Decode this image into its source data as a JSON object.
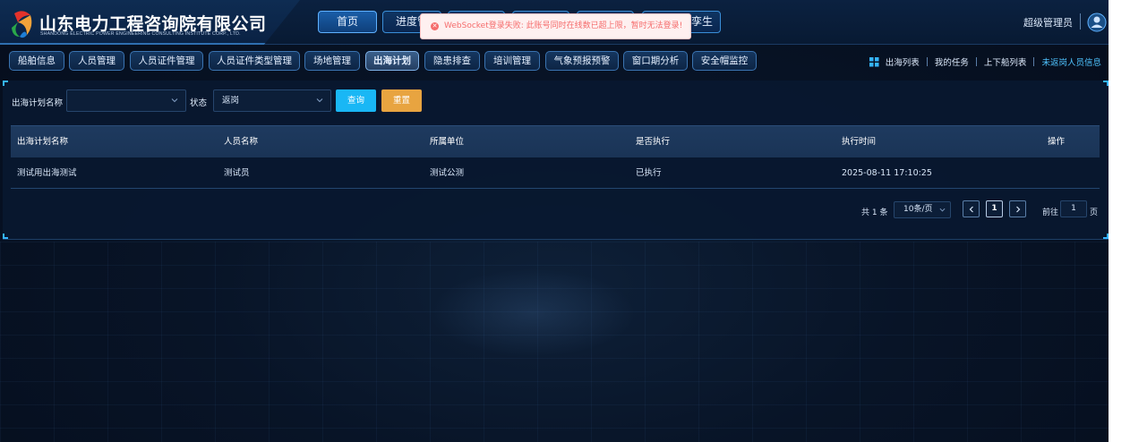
{
  "header": {
    "logo_title": "山东电力工程咨询院有限公司",
    "logo_subtitle": "SHANDONG ELECTRIC POWER ENGINEERING CONSULTING INSTITUTE CORP., LTD.",
    "top_nav": [
      {
        "label": "首页",
        "active": true
      },
      {
        "label": "进度管",
        "active": false
      },
      {
        "label": "",
        "active": false
      },
      {
        "label": "",
        "active": false
      },
      {
        "label": "",
        "active": false
      },
      {
        "label": "孪生",
        "active": false
      }
    ],
    "user_name": "超级管理员"
  },
  "toast": {
    "message": "WebSocket登录失败: 此账号同时在线数已超上限，暂时无法登录!",
    "icon": "error-circle-icon",
    "color": "#f56c6c"
  },
  "subnav": {
    "items": [
      {
        "label": "船舶信息",
        "active": false
      },
      {
        "label": "人员管理",
        "active": false
      },
      {
        "label": "人员证件管理",
        "active": false
      },
      {
        "label": "人员证件类型管理",
        "active": false
      },
      {
        "label": "场地管理",
        "active": false
      },
      {
        "label": "出海计划",
        "active": true
      },
      {
        "label": "隐患排查",
        "active": false
      },
      {
        "label": "培训管理",
        "active": false
      },
      {
        "label": "气象预报预警",
        "active": false
      },
      {
        "label": "窗口期分析",
        "active": false
      },
      {
        "label": "安全帽监控",
        "active": false
      }
    ],
    "quick_links": {
      "sea_list": "出海列表",
      "my_tasks": "我的任务",
      "boarding_list": "上下船列表",
      "not_returned": "未返岗人员信息"
    }
  },
  "filters": {
    "plan_name_label": "出海计划名称",
    "plan_name_value": "",
    "status_label": "状态",
    "status_value": "返岗",
    "query_label": "查询",
    "reset_label": "重置"
  },
  "table": {
    "columns": [
      "出海计划名称",
      "人员名称",
      "所属单位",
      "是否执行",
      "执行时间",
      "操作"
    ],
    "rows": [
      [
        "测试用出海测试",
        "测试员",
        "测试公测",
        "已执行",
        "2025-08-11 17:10:25",
        ""
      ]
    ]
  },
  "pagination": {
    "total_text": "共 1 条",
    "page_size": "10条/页",
    "current_page": "1",
    "goto_label": "前往",
    "goto_value": "1",
    "goto_unit": "页"
  },
  "colors": {
    "accent": "#19b7f5",
    "reset": "#e8a440",
    "highlight_link": "#4fc3ff"
  }
}
